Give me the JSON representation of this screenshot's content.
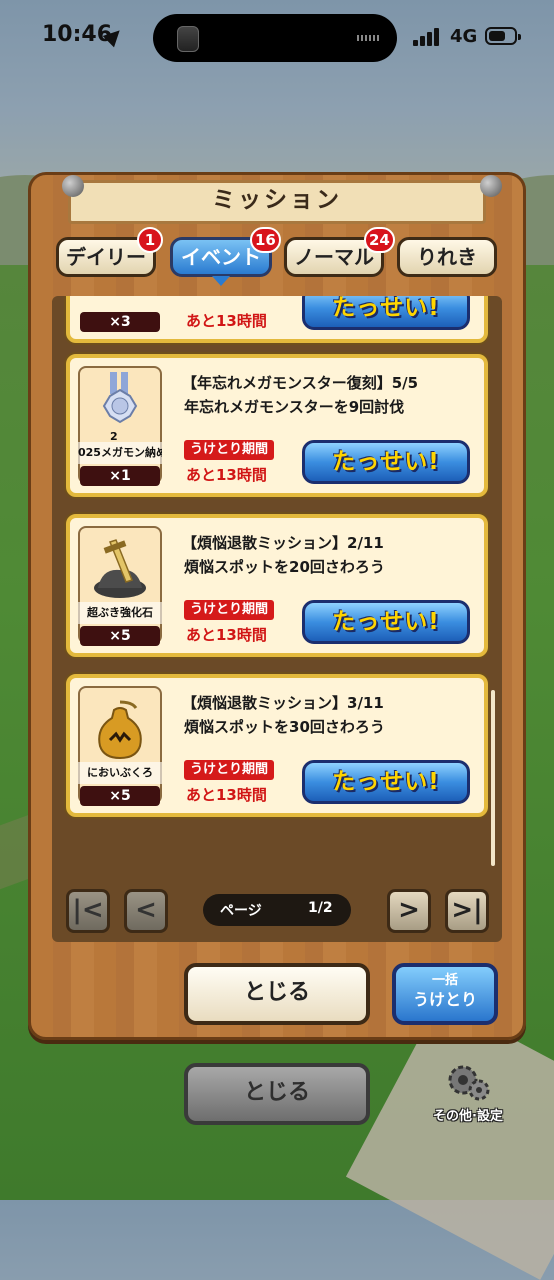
{
  "status_bar": {
    "time": "10:46",
    "network": "4G"
  },
  "dialog": {
    "title": "ミッション"
  },
  "tabs": [
    {
      "label": "デイリー",
      "badge": "1"
    },
    {
      "label": "イベント",
      "badge": "16",
      "active": true
    },
    {
      "label": "ノーマル",
      "badge": "24"
    },
    {
      "label": "りれき"
    }
  ],
  "missions": [
    {
      "item_qty": "×3",
      "remaining": "あと13時間",
      "button": "たっせい!"
    },
    {
      "title": "【年忘れメガモンスター復刻】5/5",
      "description": "年忘れメガモンスターを9回討伐",
      "item_number": "2",
      "item_name": "025メガモン納め",
      "item_qty": "×1",
      "period_label": "うけとり期間",
      "remaining": "あと13時間",
      "button": "たっせい!"
    },
    {
      "title": "【煩悩退散ミッション】2/11",
      "description": "煩悩スポットを20回さわろう",
      "item_name": "超ぶき強化石",
      "item_qty": "×5",
      "period_label": "うけとり期間",
      "remaining": "あと13時間",
      "button": "たっせい!"
    },
    {
      "title": "【煩悩退散ミッション】3/11",
      "description": "煩悩スポットを30回さわろう",
      "item_name": "においぶくろ",
      "item_qty": "×5",
      "period_label": "うけとり期間",
      "remaining": "あと13時間",
      "button": "たっせい!"
    }
  ],
  "pager": {
    "label": "ページ",
    "value": "1/2"
  },
  "buttons": {
    "close": "とじる",
    "bulk_line1": "一括",
    "bulk_line2": "うけとり",
    "close_back": "とじる",
    "settings": "その他·設定"
  }
}
